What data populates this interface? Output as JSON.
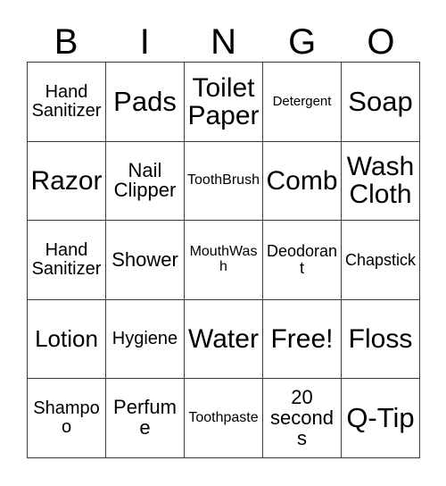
{
  "card": {
    "title": "BINGO Card",
    "header_letters": [
      "B",
      "I",
      "N",
      "G",
      "O"
    ],
    "colors": {
      "background": "#ffffff",
      "text": "#000000",
      "grid_line": "#3a3a3a"
    },
    "grid_size": {
      "rows": 5,
      "columns": 5
    },
    "rows": [
      [
        {
          "label": "Hand Sanitizer",
          "size": "sm"
        },
        {
          "label": "Pads",
          "size": "xxl"
        },
        {
          "label": "Toilet Paper",
          "size": "xl"
        },
        {
          "label": "Detergent",
          "size": "tiny"
        },
        {
          "label": "Soap",
          "size": "xxl"
        }
      ],
      [
        {
          "label": "Razor",
          "size": "xl"
        },
        {
          "label": "Nail Clipper",
          "size": "md"
        },
        {
          "label": "ToothBrush",
          "size": "xxs"
        },
        {
          "label": "Comb",
          "size": "xl"
        },
        {
          "label": "Wash Cloth",
          "size": "xl"
        }
      ],
      [
        {
          "label": "Hand Sanitizer",
          "size": "sm"
        },
        {
          "label": "Shower",
          "size": "md"
        },
        {
          "label": "MouthWash",
          "size": "xxs"
        },
        {
          "label": "Deodorant",
          "size": "xs"
        },
        {
          "label": "Chapstick",
          "size": "xs"
        }
      ],
      [
        {
          "label": "Lotion",
          "size": "lg"
        },
        {
          "label": "Hygiene",
          "size": "sm"
        },
        {
          "label": "Water",
          "size": "xl"
        },
        {
          "label": "Free!",
          "size": "xl"
        },
        {
          "label": "Floss",
          "size": "xl"
        }
      ],
      [
        {
          "label": "Shampoo",
          "size": "sm"
        },
        {
          "label": "Perfume",
          "size": "md"
        },
        {
          "label": "Toothpaste",
          "size": "xxs"
        },
        {
          "label": "20 seconds",
          "size": "md"
        },
        {
          "label": "Q-Tip",
          "size": "xxl"
        }
      ]
    ]
  }
}
